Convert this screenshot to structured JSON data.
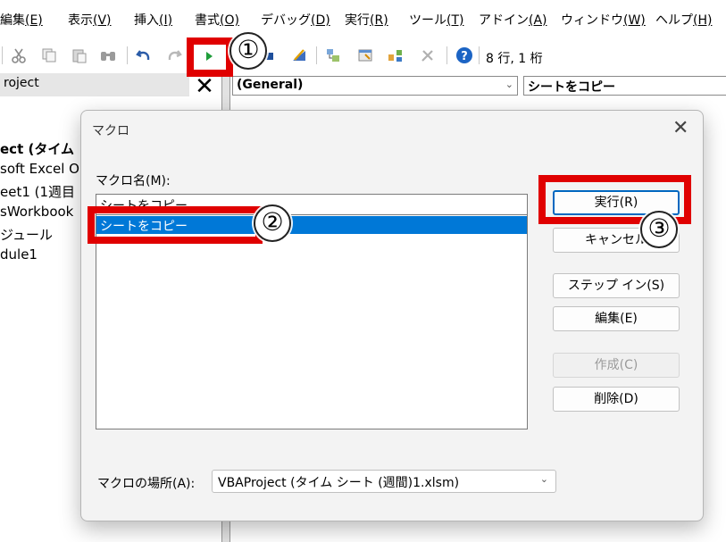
{
  "menu": {
    "items": [
      {
        "label": "編集",
        "key": "(E)"
      },
      {
        "label": "表示",
        "key": "(V)"
      },
      {
        "label": "挿入",
        "key": "(I)"
      },
      {
        "label": "書式",
        "key": "(O)"
      },
      {
        "label": "デバッグ",
        "key": "(D)"
      },
      {
        "label": "実行",
        "key": "(R)"
      },
      {
        "label": "ツール",
        "key": "(T)"
      },
      {
        "label": "アドイン",
        "key": "(A)"
      },
      {
        "label": "ウィンドウ",
        "key": "(W)"
      },
      {
        "label": "ヘルプ",
        "key": "(H)"
      }
    ]
  },
  "toolbar": {
    "cursor_position": "8 行, 1 桁",
    "icons": [
      "cut-icon",
      "copy-icon",
      "paste-icon",
      "find-icon",
      "undo-icon",
      "redo-icon",
      "run-icon",
      "stop-icon",
      "design-mode-icon",
      "project-explorer-icon",
      "properties-icon",
      "object-browser-icon",
      "toolbox-icon",
      "help-icon"
    ]
  },
  "project_pane": {
    "title": "roject",
    "close_glyph": "✕",
    "tree": [
      "ect (タイム",
      "soft Excel O",
      "eet1 (1週目",
      "sWorkbook",
      "ジュール",
      "dule1"
    ]
  },
  "code_pane": {
    "object_combo": "(General)",
    "procedure_combo": "シートをコピー"
  },
  "dialog": {
    "title": "マクロ",
    "close_glyph": "✕",
    "macro_name_label": "マクロ名(M):",
    "macro_name_value": "シートをコピー",
    "macro_list": [
      "シートをコピー"
    ],
    "buttons": {
      "run": "実行(R)",
      "cancel": "キャンセル",
      "step_into": "ステップ イン(S)",
      "edit": "編集(E)",
      "create": "作成(C)",
      "delete": "削除(D)"
    },
    "location_label": "マクロの場所(A):",
    "location_value": "VBAProject (タイム シート (週間)1.xlsm)"
  },
  "annotations": {
    "badges": [
      "①",
      "②",
      "③"
    ],
    "color": "#e00000"
  },
  "colors": {
    "accent": "#0078d7",
    "highlight": "#e00000"
  }
}
